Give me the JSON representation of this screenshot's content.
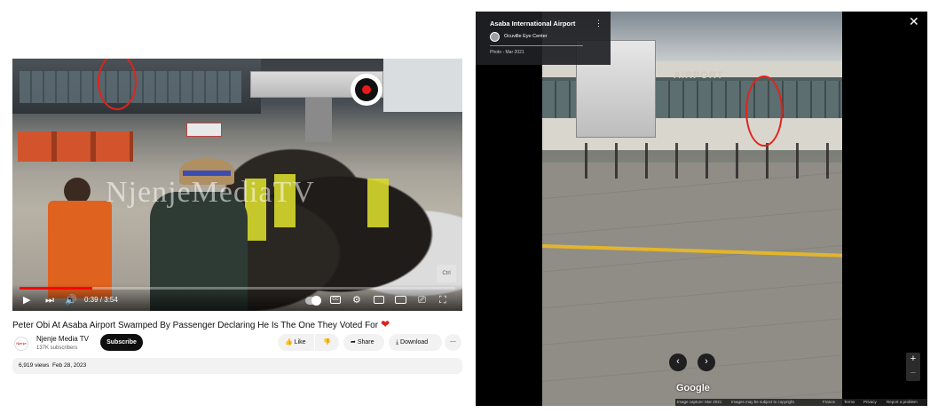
{
  "youtube": {
    "video": {
      "watermark": "NjenjeMediaTV",
      "corner_badge": "Ctrl",
      "time_current": "0:39",
      "time_total": "3:54",
      "time_separator": " / ",
      "progress_fraction": 0.167
    },
    "title": "Peter Obi At Asaba Airport Swamped By Passenger Declaring He Is The One They Voted For",
    "channel": {
      "name": "Njenje Media TV",
      "subscribers": "137K subscribers",
      "avatar_text": "Njenje"
    },
    "buttons": {
      "subscribe": "Subscribe",
      "like": "Like",
      "share": "Share",
      "download": "Download"
    },
    "meta": {
      "views": "6,919 views",
      "date": "Feb 28, 2023"
    },
    "icons": [
      "play-icon",
      "next-icon",
      "volume-icon",
      "autoplay-toggle",
      "captions-icon",
      "settings-icon",
      "miniplayer-icon",
      "theater-icon",
      "cast-icon",
      "fullscreen-icon",
      "record-icon",
      "heart-icon"
    ],
    "colors": {
      "progress": "#ff0000",
      "heart": "#e0201c",
      "annotation": "#e2231a"
    }
  },
  "streetview": {
    "place_title": "Asaba International Airport",
    "contributor": "Ocuville Eye Center",
    "photo_date": "Photo - Mar 2021",
    "building_sign": "AIRPORT",
    "google_logo": "Google",
    "zoom_in": "+",
    "zoom_out": "−",
    "footer": {
      "capture": "Image capture: Mar 2021",
      "copyright": "Images may be subject to copyright.",
      "country": "France",
      "terms": "Terms",
      "privacy": "Privacy",
      "report": "Report a problem"
    },
    "icons": [
      "kebab-menu-icon",
      "close-icon",
      "chevron-left-icon",
      "chevron-right-icon"
    ]
  }
}
